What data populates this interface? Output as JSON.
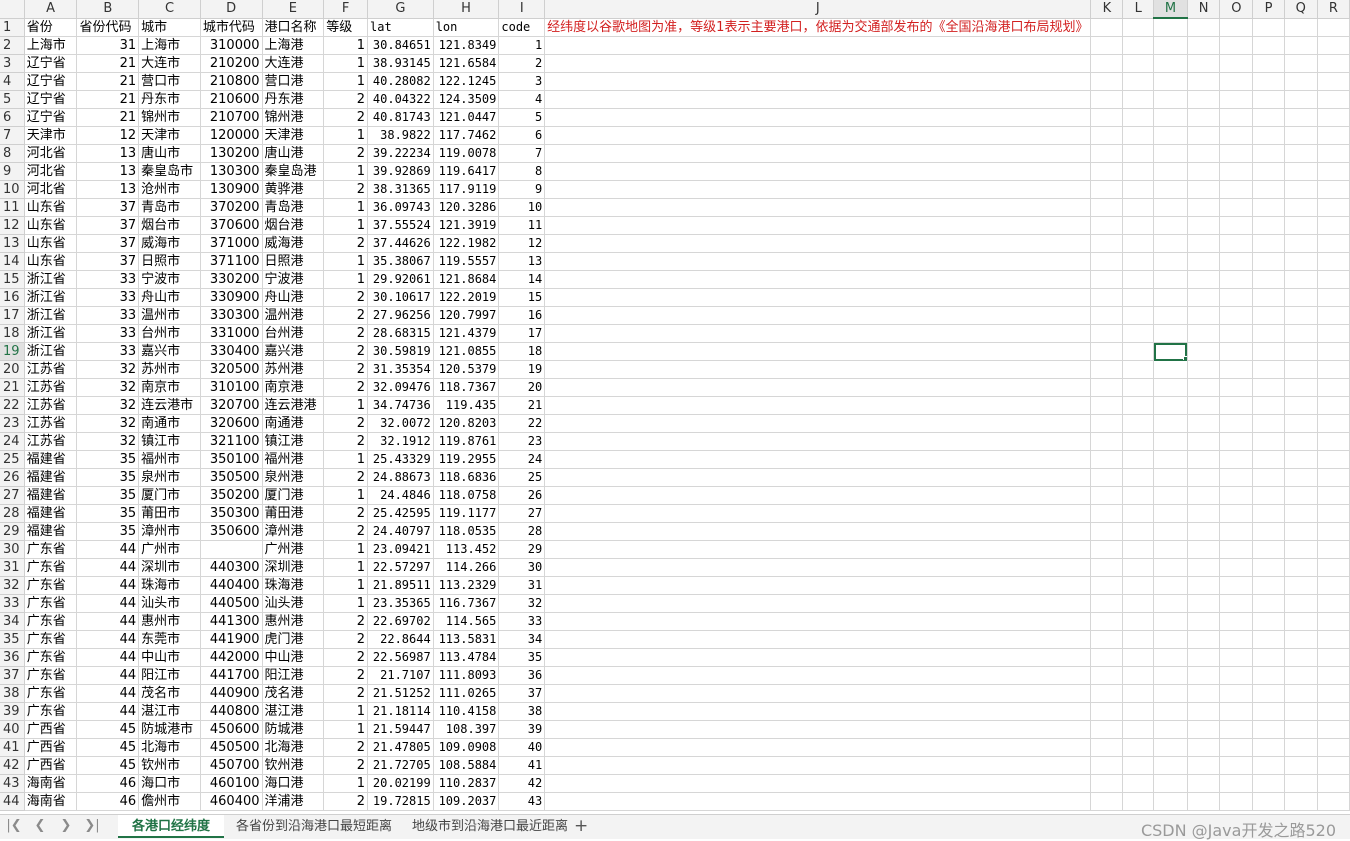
{
  "columns": [
    "A",
    "B",
    "C",
    "D",
    "E",
    "F",
    "G",
    "H",
    "I",
    "J",
    "K",
    "L",
    "M",
    "N",
    "O",
    "P",
    "Q",
    "R"
  ],
  "active_column": "M",
  "active_row": 19,
  "note_text": "经纬度以谷歌地图为准，等级1表示主要港口，依据为交通部发布的《全国沿海港口布局规划》",
  "header_row": [
    "省份",
    "省份代码",
    "城市",
    "城市代码",
    "港口名称",
    "等级",
    "lat",
    "lon",
    "code"
  ],
  "rows": [
    [
      "上海市",
      "31",
      "上海市",
      "310000",
      "上海港",
      "1",
      "30.84651",
      "121.8349",
      "1"
    ],
    [
      "辽宁省",
      "21",
      "大连市",
      "210200",
      "大连港",
      "1",
      "38.93145",
      "121.6584",
      "2"
    ],
    [
      "辽宁省",
      "21",
      "营口市",
      "210800",
      "营口港",
      "1",
      "40.28082",
      "122.1245",
      "3"
    ],
    [
      "辽宁省",
      "21",
      "丹东市",
      "210600",
      "丹东港",
      "2",
      "40.04322",
      "124.3509",
      "4"
    ],
    [
      "辽宁省",
      "21",
      "锦州市",
      "210700",
      "锦州港",
      "2",
      "40.81743",
      "121.0447",
      "5"
    ],
    [
      "天津市",
      "12",
      "天津市",
      "120000",
      "天津港",
      "1",
      "38.9822",
      "117.7462",
      "6"
    ],
    [
      "河北省",
      "13",
      "唐山市",
      "130200",
      "唐山港",
      "2",
      "39.22234",
      "119.0078",
      "7"
    ],
    [
      "河北省",
      "13",
      "秦皇岛市",
      "130300",
      "秦皇岛港",
      "1",
      "39.92869",
      "119.6417",
      "8"
    ],
    [
      "河北省",
      "13",
      "沧州市",
      "130900",
      "黄骅港",
      "2",
      "38.31365",
      "117.9119",
      "9"
    ],
    [
      "山东省",
      "37",
      "青岛市",
      "370200",
      "青岛港",
      "1",
      "36.09743",
      "120.3286",
      "10"
    ],
    [
      "山东省",
      "37",
      "烟台市",
      "370600",
      "烟台港",
      "1",
      "37.55524",
      "121.3919",
      "11"
    ],
    [
      "山东省",
      "37",
      "威海市",
      "371000",
      "威海港",
      "2",
      "37.44626",
      "122.1982",
      "12"
    ],
    [
      "山东省",
      "37",
      "日照市",
      "371100",
      "日照港",
      "1",
      "35.38067",
      "119.5557",
      "13"
    ],
    [
      "浙江省",
      "33",
      "宁波市",
      "330200",
      "宁波港",
      "1",
      "29.92061",
      "121.8684",
      "14"
    ],
    [
      "浙江省",
      "33",
      "舟山市",
      "330900",
      "舟山港",
      "2",
      "30.10617",
      "122.2019",
      "15"
    ],
    [
      "浙江省",
      "33",
      "温州市",
      "330300",
      "温州港",
      "2",
      "27.96256",
      "120.7997",
      "16"
    ],
    [
      "浙江省",
      "33",
      "台州市",
      "331000",
      "台州港",
      "2",
      "28.68315",
      "121.4379",
      "17"
    ],
    [
      "浙江省",
      "33",
      "嘉兴市",
      "330400",
      "嘉兴港",
      "2",
      "30.59819",
      "121.0855",
      "18"
    ],
    [
      "江苏省",
      "32",
      "苏州市",
      "320500",
      "苏州港",
      "2",
      "31.35354",
      "120.5379",
      "19"
    ],
    [
      "江苏省",
      "32",
      "南京市",
      "310100",
      "南京港",
      "2",
      "32.09476",
      "118.7367",
      "20"
    ],
    [
      "江苏省",
      "32",
      "连云港市",
      "320700",
      "连云港港",
      "1",
      "34.74736",
      "119.435",
      "21"
    ],
    [
      "江苏省",
      "32",
      "南通市",
      "320600",
      "南通港",
      "2",
      "32.0072",
      "120.8203",
      "22"
    ],
    [
      "江苏省",
      "32",
      "镇江市",
      "321100",
      "镇江港",
      "2",
      "32.1912",
      "119.8761",
      "23"
    ],
    [
      "福建省",
      "35",
      "福州市",
      "350100",
      "福州港",
      "1",
      "25.43329",
      "119.2955",
      "24"
    ],
    [
      "福建省",
      "35",
      "泉州市",
      "350500",
      "泉州港",
      "2",
      "24.88673",
      "118.6836",
      "25"
    ],
    [
      "福建省",
      "35",
      "厦门市",
      "350200",
      "厦门港",
      "1",
      "24.4846",
      "118.0758",
      "26"
    ],
    [
      "福建省",
      "35",
      "莆田市",
      "350300",
      "莆田港",
      "2",
      "25.42595",
      "119.1177",
      "27"
    ],
    [
      "福建省",
      "35",
      "漳州市",
      "350600",
      "漳州港",
      "2",
      "24.40797",
      "118.0535",
      "28"
    ],
    [
      "广东省",
      "44",
      "广州市",
      "",
      "广州港",
      "1",
      "23.09421",
      "113.452",
      "29"
    ],
    [
      "广东省",
      "44",
      "深圳市",
      "440300",
      "深圳港",
      "1",
      "22.57297",
      "114.266",
      "30"
    ],
    [
      "广东省",
      "44",
      "珠海市",
      "440400",
      "珠海港",
      "1",
      "21.89511",
      "113.2329",
      "31"
    ],
    [
      "广东省",
      "44",
      "汕头市",
      "440500",
      "汕头港",
      "1",
      "23.35365",
      "116.7367",
      "32"
    ],
    [
      "广东省",
      "44",
      "惠州市",
      "441300",
      "惠州港",
      "2",
      "22.69702",
      "114.565",
      "33"
    ],
    [
      "广东省",
      "44",
      "东莞市",
      "441900",
      "虎门港",
      "2",
      "22.8644",
      "113.5831",
      "34"
    ],
    [
      "广东省",
      "44",
      "中山市",
      "442000",
      "中山港",
      "2",
      "22.56987",
      "113.4784",
      "35"
    ],
    [
      "广东省",
      "44",
      "阳江市",
      "441700",
      "阳江港",
      "2",
      "21.7107",
      "111.8093",
      "36"
    ],
    [
      "广东省",
      "44",
      "茂名市",
      "440900",
      "茂名港",
      "2",
      "21.51252",
      "111.0265",
      "37"
    ],
    [
      "广东省",
      "44",
      "湛江市",
      "440800",
      "湛江港",
      "1",
      "21.18114",
      "110.4158",
      "38"
    ],
    [
      "广西省",
      "45",
      "防城港市",
      "450600",
      "防城港",
      "1",
      "21.59447",
      "108.397",
      "39"
    ],
    [
      "广西省",
      "45",
      "北海市",
      "450500",
      "北海港",
      "2",
      "21.47805",
      "109.0908",
      "40"
    ],
    [
      "广西省",
      "45",
      "钦州市",
      "450700",
      "钦州港",
      "2",
      "21.72705",
      "108.5884",
      "41"
    ],
    [
      "海南省",
      "46",
      "海口市",
      "460100",
      "海口港",
      "1",
      "20.02199",
      "110.2837",
      "42"
    ],
    [
      "海南省",
      "46",
      "儋州市",
      "460400",
      "洋浦港",
      "2",
      "19.72815",
      "109.2037",
      "43"
    ]
  ],
  "sheet_tabs": [
    "各港口经纬度",
    "各省份到沿海港口最短距离",
    "地级市到沿海港口最近距离"
  ],
  "active_tab_index": 0,
  "nav_icons": [
    "first-sheet-icon",
    "prev-sheet-icon",
    "next-sheet-icon",
    "last-sheet-icon"
  ],
  "add_sheet_icon": "plus-icon",
  "watermark": "CSDN @Java开发之路520",
  "colors": {
    "accent": "#217346",
    "note": "#d21f1f",
    "grid": "#d6d6d6",
    "header_bg": "#f3f3f3"
  }
}
